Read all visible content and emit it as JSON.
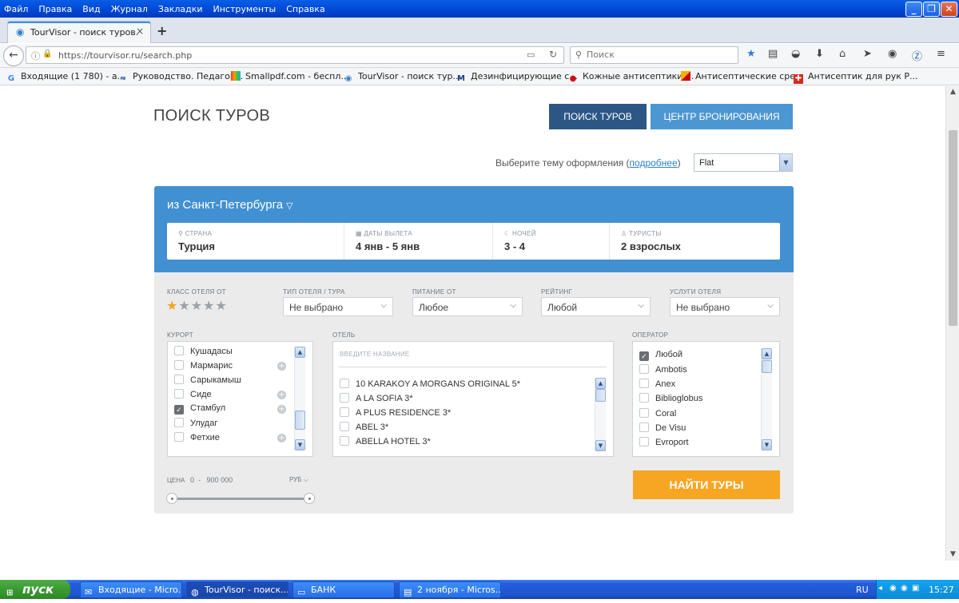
{
  "menu": [
    "Файл",
    "Правка",
    "Вид",
    "Журнал",
    "Закладки",
    "Инструменты",
    "Справка"
  ],
  "window_buttons": [
    "_",
    "❐",
    "✕"
  ],
  "tab": {
    "title": "TourVisor - поиск туров.",
    "close": "×",
    "new": "+"
  },
  "nav": {
    "url": "https://tourvisor.ru/search.php",
    "search_placeholder": "Поиск"
  },
  "bookmarks": [
    "Входящие (1 780) - а...",
    "Руководство. Педагог...",
    "Smallpdf.com - беспл...",
    "TourVisor - поиск тур...",
    "Дезинфицирующие с...",
    "Кожные антисептики ...",
    "Антисептические сре...",
    "Антисептик для рук Р..."
  ],
  "page": {
    "title": "ПОИСК ТУРОВ",
    "btn_search": "ПОИСК ТУРОВ",
    "btn_booking": "ЦЕНТР БРОНИРОВАНИЯ",
    "theme_label": "Выберите тему оформления (",
    "theme_link": "подробнее",
    "theme_close": ")",
    "theme_value": "Flat"
  },
  "search": {
    "from": "из Санкт-Петербурга",
    "fields": [
      {
        "label": "СТРАНА",
        "value": "Турция"
      },
      {
        "label": "ДАТЫ ВЫЛЕТА",
        "value": "4 янв - 5 янв"
      },
      {
        "label": "НОЧЕЙ",
        "value": "3 - 4"
      },
      {
        "label": "ТУРИСТЫ",
        "value": "2 взрослых"
      }
    ]
  },
  "filters": {
    "stars_label": "КЛАСС ОТЕЛЯ ОТ",
    "stars_selected": 1,
    "stars_total": 5,
    "hotel_type": {
      "label": "ТИП ОТЕЛЯ / ТУРА",
      "value": "Не выбрано"
    },
    "meal": {
      "label": "ПИТАНИЕ ОТ",
      "value": "Любое"
    },
    "rating": {
      "label": "РЕЙТИНГ",
      "value": "Любой"
    },
    "services": {
      "label": "УСЛУГИ ОТЕЛЯ",
      "value": "Не выбрано"
    }
  },
  "resorts": {
    "label": "КУРОРТ",
    "items": [
      {
        "name": "Кушадасы",
        "checked": false,
        "plus": false
      },
      {
        "name": "Мармарис",
        "checked": false,
        "plus": true
      },
      {
        "name": "Сарыкамыш",
        "checked": false,
        "plus": false
      },
      {
        "name": "Сиде",
        "checked": false,
        "plus": true
      },
      {
        "name": "Стамбул",
        "checked": true,
        "plus": true
      },
      {
        "name": "Улудаг",
        "checked": false,
        "plus": false
      },
      {
        "name": "Фетхие",
        "checked": false,
        "plus": true
      }
    ]
  },
  "hotels": {
    "label": "ОТЕЛЬ",
    "placeholder": "ВВЕДИТЕ НАЗВАНИЕ",
    "items": [
      "10 KARAKOY A MORGANS ORIGINAL 5*",
      "A LA SOFIA 3*",
      "A PLUS RESIDENCE 3*",
      "ABEL 3*",
      "ABELLA HOTEL 3*"
    ]
  },
  "operators": {
    "label": "ОПЕРАТОР",
    "items": [
      {
        "name": "Любой",
        "checked": true
      },
      {
        "name": "Ambotis",
        "checked": false
      },
      {
        "name": "Anex",
        "checked": false
      },
      {
        "name": "Biblioglobus",
        "checked": false
      },
      {
        "name": "Coral",
        "checked": false
      },
      {
        "name": "De Visu",
        "checked": false
      },
      {
        "name": "Evroport",
        "checked": false
      }
    ]
  },
  "price": {
    "label": "ЦЕНА",
    "min": "0",
    "sep": "-",
    "max": "900 000",
    "currency": "РУБ"
  },
  "find_button": "НАЙТИ ТУРЫ",
  "taskbar": {
    "start": "пуск",
    "tasks": [
      "Входящие - Micro...",
      "TourVisor - поиск...",
      "БАНК",
      "2 ноября - Micros..."
    ],
    "lang": "RU",
    "time": "15:27"
  }
}
